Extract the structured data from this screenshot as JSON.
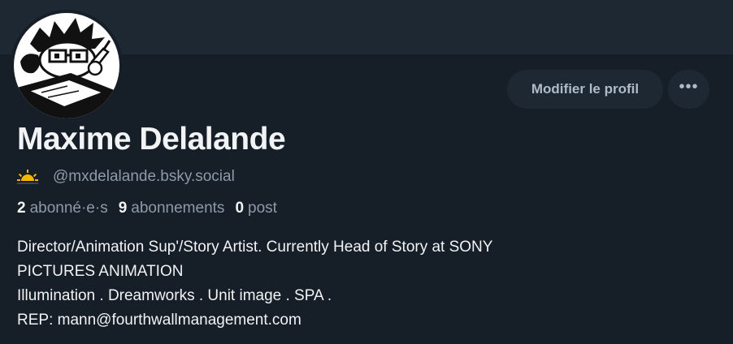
{
  "profile": {
    "display_name": "Maxime Delalande",
    "handle": "@mxdelalande.bsky.social",
    "status_icon": "sunrise-icon"
  },
  "actions": {
    "edit_label": "Modifier le profil",
    "more_label": "•••"
  },
  "stats": {
    "followers_count": "2",
    "followers_label": "abonné·e·s",
    "following_count": "9",
    "following_label": "abonnements",
    "posts_count": "0",
    "posts_label": "post"
  },
  "bio": {
    "lines": [
      "Director/Animation Sup'/Story Artist. Currently Head of Story at SONY",
      "PICTURES ANIMATION",
      "Illumination . Dreamworks . Unit image . SPA .",
      "REP: mann@fourthwallmanagement.com"
    ]
  },
  "colors": {
    "background": "#161e27",
    "banner": "#1e2833",
    "text_primary": "#f1f3f5",
    "text_secondary": "#8d9aa8",
    "button_bg": "#1e2833",
    "accent_sun": "#f5b800"
  }
}
